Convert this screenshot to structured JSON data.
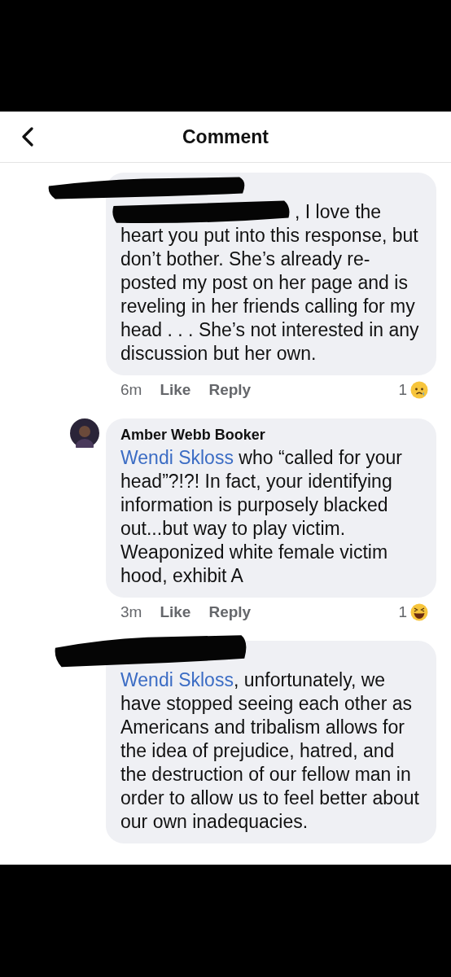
{
  "header": {
    "title": "Comment"
  },
  "comments": [
    {
      "author_hidden": true,
      "start_hidden": true,
      "body": {
        "lead": ", I love the",
        "text": "heart you put into this response, but don’t bother. She’s already re-posted my post on her page and is reveling in her friends calling for my head . . . She’s not interested in any discussion but her own."
      },
      "footer": {
        "time": "6m",
        "like": "Like",
        "reply": "Reply",
        "reaction": {
          "count": "1",
          "kind": "sad"
        }
      }
    },
    {
      "author_hidden": false,
      "start_hidden": false,
      "author": "Amber Webb Booker",
      "body": {
        "mention": "Wendi Skloss",
        "text": " who “called for your head”?!?! In fact, your identifying information is purposely blacked out...but way to play victim. Weaponized white female victim hood, exhibit A"
      },
      "footer": {
        "time": "3m",
        "like": "Like",
        "reply": "Reply",
        "reaction": {
          "count": "1",
          "kind": "haha"
        }
      }
    },
    {
      "author_hidden": true,
      "start_hidden": false,
      "body": {
        "mention": "Wendi Skloss",
        "text": ", unfortunately, we have stopped seeing each other as Americans and tribalism allows for the idea of prejudice, hatred, and the destruction of our fellow man in order to allow us to feel better about our own inadequacies."
      }
    }
  ]
}
